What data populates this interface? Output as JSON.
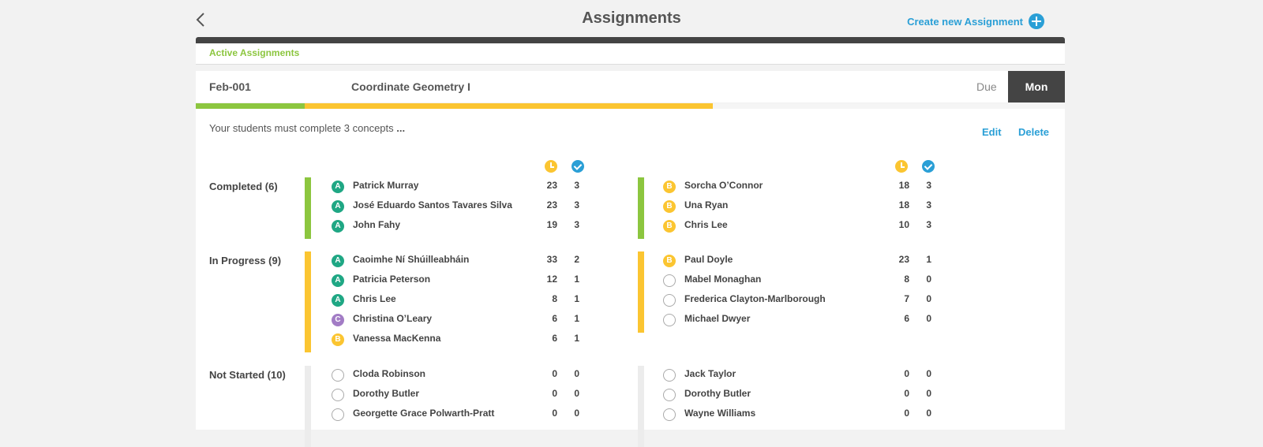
{
  "header": {
    "title": "Assignments",
    "create_label": "Create new Assignment"
  },
  "tabs": {
    "active": "Active Assignments"
  },
  "assignment": {
    "code": "Feb-001",
    "name": "Coordinate Geometry I",
    "due_label": "Due",
    "due_day": "Mon",
    "progress": {
      "completed_fraction": 0.125,
      "in_progress_fraction": 0.47
    },
    "description": "Your students must complete 3 concepts",
    "ellipsis": "...",
    "edit_label": "Edit",
    "delete_label": "Delete"
  },
  "groups": [
    {
      "label": "Completed (6)",
      "color": "#8cc63f",
      "left": [
        {
          "badge": "A",
          "name": "Patrick Murray",
          "time": "23",
          "done": "3"
        },
        {
          "badge": "A",
          "name": "José Eduardo Santos Tavares Silva",
          "time": "23",
          "done": "3"
        },
        {
          "badge": "A",
          "name": "John Fahy",
          "time": "19",
          "done": "3"
        }
      ],
      "right": [
        {
          "badge": "B",
          "name": "Sorcha O’Connor",
          "time": "18",
          "done": "3"
        },
        {
          "badge": "B",
          "name": "Una Ryan",
          "time": "18",
          "done": "3"
        },
        {
          "badge": "B",
          "name": "Chris Lee",
          "time": "10",
          "done": "3"
        }
      ]
    },
    {
      "label": "In Progress (9)",
      "color": "#fbc531",
      "left": [
        {
          "badge": "A",
          "name": "Caoimhe Ní Shúilleabháin",
          "time": "33",
          "done": "2"
        },
        {
          "badge": "A",
          "name": "Patricia Peterson",
          "time": "12",
          "done": "1"
        },
        {
          "badge": "A",
          "name": "Chris Lee",
          "time": "8",
          "done": "1"
        },
        {
          "badge": "C",
          "name": "Christina O’Leary",
          "time": "6",
          "done": "1"
        },
        {
          "badge": "B",
          "name": "Vanessa MacKenna",
          "time": "6",
          "done": "1"
        }
      ],
      "right": [
        {
          "badge": "B",
          "name": "Paul Doyle",
          "time": "23",
          "done": "1"
        },
        {
          "badge": "",
          "name": "Mabel Monaghan",
          "time": "8",
          "done": "0"
        },
        {
          "badge": "",
          "name": "Frederica Clayton-Marlborough",
          "time": "7",
          "done": "0"
        },
        {
          "badge": "",
          "name": "Michael Dwyer",
          "time": "6",
          "done": "0"
        }
      ]
    },
    {
      "label": "Not Started (10)",
      "color": "#ececec",
      "left": [
        {
          "badge": "",
          "name": "Cloda Robinson",
          "time": "0",
          "done": "0"
        },
        {
          "badge": "",
          "name": "Dorothy Butler",
          "time": "0",
          "done": "0"
        },
        {
          "badge": "",
          "name": "Georgette Grace Polwarth-Pratt",
          "time": "0",
          "done": "0"
        }
      ],
      "right": [
        {
          "badge": "",
          "name": "Jack Taylor",
          "time": "0",
          "done": "0"
        },
        {
          "badge": "",
          "name": "Dorothy Butler",
          "time": "0",
          "done": "0"
        },
        {
          "badge": "",
          "name": "Wayne Williams",
          "time": "0",
          "done": "0"
        }
      ]
    }
  ]
}
